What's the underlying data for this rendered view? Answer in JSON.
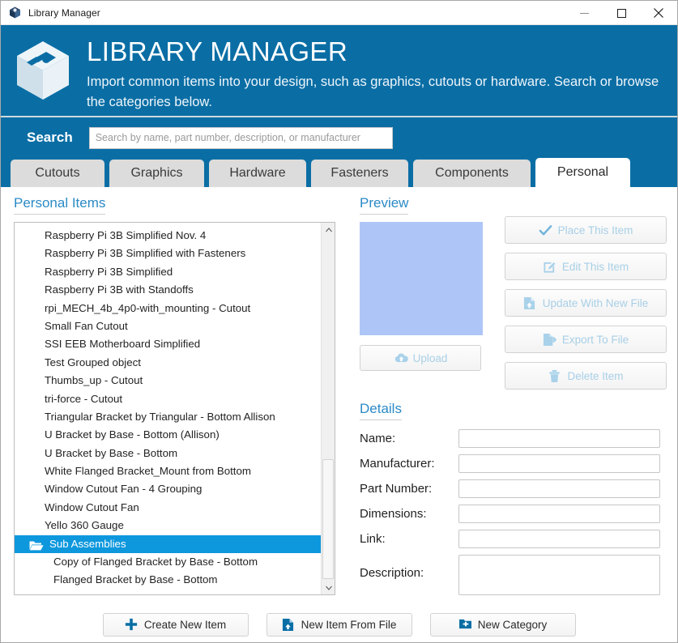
{
  "window": {
    "title": "Library Manager",
    "app_icon": "app-logo-icon",
    "controls": {
      "minimize": "minimize-icon",
      "maximize": "maximize-icon",
      "close": "close-icon"
    }
  },
  "header": {
    "title": "LIBRARY MANAGER",
    "subtitle": "Import common items into your design, such as graphics, cutouts or hardware. Search or browse the categories below.",
    "logo": "isometric-p-cube-logo",
    "background_color": "#0a6ea5"
  },
  "search": {
    "label": "Search",
    "placeholder": "Search by name, part number, description, or manufacturer",
    "value": ""
  },
  "tabs": [
    {
      "label": "Cutouts",
      "active": false
    },
    {
      "label": "Graphics",
      "active": false
    },
    {
      "label": "Hardware",
      "active": false
    },
    {
      "label": "Fasteners",
      "active": false
    },
    {
      "label": "Components",
      "active": false
    },
    {
      "label": "Personal",
      "active": true
    }
  ],
  "personal_items": {
    "heading": "Personal Items",
    "selected_index": 17,
    "items": [
      {
        "label": "Raspberry Pi 3B Simplified Nov. 4",
        "type": "item",
        "indent": 0
      },
      {
        "label": "Raspberry Pi 3B Simplified with Fasteners",
        "type": "item",
        "indent": 0
      },
      {
        "label": "Raspberry Pi 3B Simplified",
        "type": "item",
        "indent": 0
      },
      {
        "label": "Raspberry Pi 3B with Standoffs",
        "type": "item",
        "indent": 0
      },
      {
        "label": "rpi_MECH_4b_4p0-with_mounting - Cutout",
        "type": "item",
        "indent": 0
      },
      {
        "label": "Small Fan Cutout",
        "type": "item",
        "indent": 0
      },
      {
        "label": "SSI EEB Motherboard Simplified",
        "type": "item",
        "indent": 0
      },
      {
        "label": "Test Grouped object",
        "type": "item",
        "indent": 0
      },
      {
        "label": "Thumbs_up - Cutout",
        "type": "item",
        "indent": 0
      },
      {
        "label": "tri-force - Cutout",
        "type": "item",
        "indent": 0
      },
      {
        "label": "Triangular Bracket by Triangular - Bottom Allison",
        "type": "item",
        "indent": 0
      },
      {
        "label": "U Bracket by Base - Bottom (Allison)",
        "type": "item",
        "indent": 0
      },
      {
        "label": "U Bracket by Base - Bottom",
        "type": "item",
        "indent": 0
      },
      {
        "label": "White Flanged Bracket_Mount from Bottom",
        "type": "item",
        "indent": 0
      },
      {
        "label": "Window Cutout Fan - 4 Grouping",
        "type": "item",
        "indent": 0
      },
      {
        "label": "Window Cutout Fan",
        "type": "item",
        "indent": 0
      },
      {
        "label": "Yello 360 Gauge",
        "type": "item",
        "indent": 0
      },
      {
        "label": "Sub Assemblies",
        "type": "folder",
        "indent": 0
      },
      {
        "label": "Copy of Flanged Bracket by Base - Bottom",
        "type": "item",
        "indent": 1
      },
      {
        "label": "Flanged Bracket by Base - Bottom",
        "type": "item",
        "indent": 1
      }
    ],
    "selection_color": "#0d97dd"
  },
  "preview": {
    "heading": "Preview",
    "image_placeholder_color": "#aec6f7",
    "upload_button": {
      "label": "Upload",
      "icon": "cloud-upload-icon",
      "enabled": false
    }
  },
  "actions": [
    {
      "label": "Place This Item",
      "icon": "check-icon",
      "enabled": false
    },
    {
      "label": "Edit This Item",
      "icon": "pencil-square-icon",
      "enabled": false
    },
    {
      "label": "Update With New File",
      "icon": "file-upload-icon",
      "enabled": false
    },
    {
      "label": "Export To File",
      "icon": "file-export-icon",
      "enabled": false
    },
    {
      "label": "Delete Item",
      "icon": "trash-icon",
      "enabled": false
    }
  ],
  "details": {
    "heading": "Details",
    "fields": [
      {
        "label": "Name:",
        "value": "",
        "multiline": false
      },
      {
        "label": "Manufacturer:",
        "value": "",
        "multiline": false
      },
      {
        "label": "Part Number:",
        "value": "",
        "multiline": false
      },
      {
        "label": "Dimensions:",
        "value": "",
        "multiline": false
      },
      {
        "label": "Link:",
        "value": "",
        "multiline": false
      },
      {
        "label": "Description:",
        "value": "",
        "multiline": true
      }
    ]
  },
  "bottom_buttons": [
    {
      "label": "Create New Item",
      "icon": "plus-icon",
      "enabled": true
    },
    {
      "label": "New Item From File",
      "icon": "file-upload-icon",
      "enabled": true
    },
    {
      "label": "New Category",
      "icon": "folder-plus-icon",
      "enabled": true
    }
  ]
}
